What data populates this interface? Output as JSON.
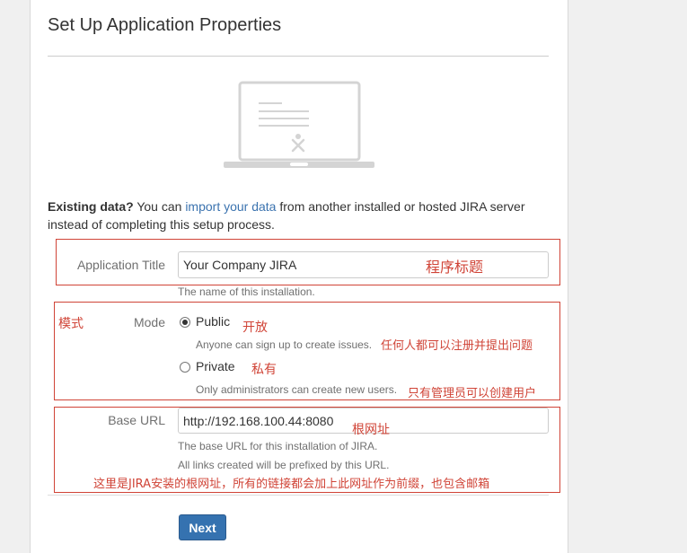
{
  "page": {
    "title": "Set Up Application Properties",
    "intro_bold": "Existing data?",
    "intro_pre": " You can ",
    "intro_link": "import your data",
    "intro_post": " from another installed or hosted JIRA server instead of completing this setup process."
  },
  "form": {
    "app_title": {
      "label": "Application Title",
      "value": "Your Company JIRA",
      "description": "The name of this installation.",
      "annotation": "程序标题"
    },
    "mode": {
      "label": "Mode",
      "annotation": "模式",
      "options": [
        {
          "label": "Public",
          "annotation": "开放",
          "description": "Anyone can sign up to create issues.",
          "description_annotation": "任何人都可以注册并提出问题",
          "checked": true
        },
        {
          "label": "Private",
          "annotation": "私有",
          "description": "Only administrators can create new users.",
          "description_annotation": "只有管理员可以创建用户",
          "checked": false
        }
      ]
    },
    "base_url": {
      "label": "Base URL",
      "value": "http://192.168.100.44:8080",
      "annotation": "根网址",
      "description_1": "The base URL for this installation of JIRA.",
      "description_2": "All links created will be prefixed by this URL.",
      "note": "这里是JIRA安装的根网址，所有的链接都会加上此网址作为前缀，也包含邮箱"
    },
    "next_label": "Next"
  },
  "colors": {
    "accent": "#3572b0",
    "link": "#3b73af",
    "annotation_red": "#d04437"
  }
}
